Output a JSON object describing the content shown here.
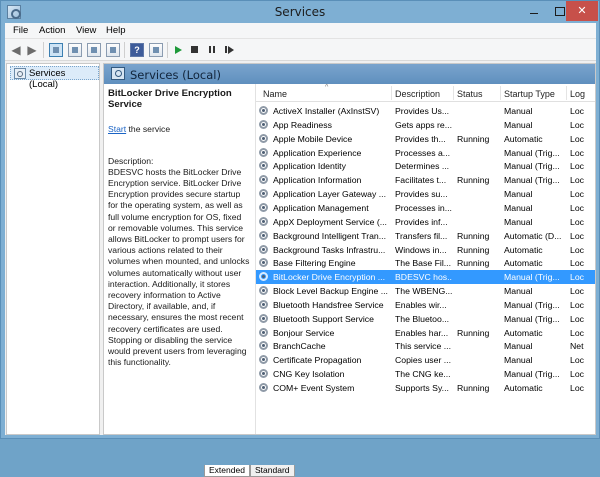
{
  "window": {
    "title": "Services",
    "minimize": "",
    "maximize": "",
    "close": "✕"
  },
  "menu": [
    "File",
    "Action",
    "View",
    "Help"
  ],
  "toolbar": {
    "back": "◀",
    "forward": "▶",
    "help": "?"
  },
  "tree": {
    "root_label": "Services (Local)"
  },
  "pane": {
    "header_title": "Services (Local)",
    "detail": {
      "service_name": "BitLocker Drive Encryption Service",
      "action_link": "Start",
      "action_suffix": " the service",
      "description_label": "Description:",
      "description_text": "BDESVC hosts the BitLocker Drive Encryption service. BitLocker Drive Encryption provides secure startup for the operating system, as well as full volume encryption for OS, fixed or removable volumes. This service allows BitLocker to prompt users for various actions related to their volumes when mounted, and unlocks volumes automatically without user interaction. Additionally, it stores recovery information to Active Directory, if available, and, if necessary, ensures the most recent recovery certificates are used. Stopping or disabling the service would prevent users from leveraging this functionality."
    }
  },
  "columns": {
    "name": "Name",
    "description": "Description",
    "status": "Status",
    "startup": "Startup Type",
    "logon": "Log"
  },
  "services": [
    {
      "name": "ActiveX Installer (AxInstSV)",
      "desc": "Provides Us...",
      "status": "",
      "startup": "Manual",
      "logon": "Loc"
    },
    {
      "name": "App Readiness",
      "desc": "Gets apps re...",
      "status": "",
      "startup": "Manual",
      "logon": "Loc"
    },
    {
      "name": "Apple Mobile Device",
      "desc": "Provides th...",
      "status": "Running",
      "startup": "Automatic",
      "logon": "Loc"
    },
    {
      "name": "Application Experience",
      "desc": "Processes a...",
      "status": "",
      "startup": "Manual (Trig...",
      "logon": "Loc"
    },
    {
      "name": "Application Identity",
      "desc": "Determines ...",
      "status": "",
      "startup": "Manual (Trig...",
      "logon": "Loc"
    },
    {
      "name": "Application Information",
      "desc": "Facilitates t...",
      "status": "Running",
      "startup": "Manual (Trig...",
      "logon": "Loc"
    },
    {
      "name": "Application Layer Gateway ...",
      "desc": "Provides su...",
      "status": "",
      "startup": "Manual",
      "logon": "Loc"
    },
    {
      "name": "Application Management",
      "desc": "Processes in...",
      "status": "",
      "startup": "Manual",
      "logon": "Loc"
    },
    {
      "name": "AppX Deployment Service (...",
      "desc": "Provides inf...",
      "status": "",
      "startup": "Manual",
      "logon": "Loc"
    },
    {
      "name": "Background Intelligent Tran...",
      "desc": "Transfers fil...",
      "status": "Running",
      "startup": "Automatic (D...",
      "logon": "Loc"
    },
    {
      "name": "Background Tasks Infrastru...",
      "desc": "Windows in...",
      "status": "Running",
      "startup": "Automatic",
      "logon": "Loc"
    },
    {
      "name": "Base Filtering Engine",
      "desc": "The Base Fil...",
      "status": "Running",
      "startup": "Automatic",
      "logon": "Loc"
    },
    {
      "name": "BitLocker Drive Encryption ...",
      "desc": "BDESVC hos...",
      "status": "",
      "startup": "Manual (Trig...",
      "logon": "Loc",
      "selected": true
    },
    {
      "name": "Block Level Backup Engine ...",
      "desc": "The WBENG...",
      "status": "",
      "startup": "Manual",
      "logon": "Loc"
    },
    {
      "name": "Bluetooth Handsfree Service",
      "desc": "Enables wir...",
      "status": "",
      "startup": "Manual (Trig...",
      "logon": "Loc"
    },
    {
      "name": "Bluetooth Support Service",
      "desc": "The Bluetoo...",
      "status": "",
      "startup": "Manual (Trig...",
      "logon": "Loc"
    },
    {
      "name": "Bonjour Service",
      "desc": "Enables har...",
      "status": "Running",
      "startup": "Automatic",
      "logon": "Loc"
    },
    {
      "name": "BranchCache",
      "desc": "This service ...",
      "status": "",
      "startup": "Manual",
      "logon": "Net"
    },
    {
      "name": "Certificate Propagation",
      "desc": "Copies user ...",
      "status": "",
      "startup": "Manual",
      "logon": "Loc"
    },
    {
      "name": "CNG Key Isolation",
      "desc": "The CNG ke...",
      "status": "",
      "startup": "Manual (Trig...",
      "logon": "Loc"
    },
    {
      "name": "COM+ Event System",
      "desc": "Supports Sy...",
      "status": "Running",
      "startup": "Automatic",
      "logon": "Loc"
    }
  ],
  "tabs": {
    "extended": "Extended",
    "standard": "Standard"
  }
}
